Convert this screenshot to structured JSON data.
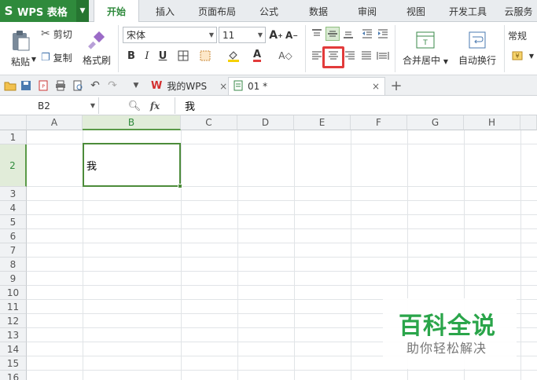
{
  "app": {
    "title": "WPS 表格",
    "logo": "S"
  },
  "menu_tabs": [
    {
      "label": "开始",
      "active": true
    },
    {
      "label": "插入"
    },
    {
      "label": "页面布局"
    },
    {
      "label": "公式"
    },
    {
      "label": "数据"
    },
    {
      "label": "审阅"
    },
    {
      "label": "视图"
    },
    {
      "label": "开发工具"
    },
    {
      "label": "云服务"
    }
  ],
  "ribbon": {
    "paste_label": "粘贴",
    "cut_label": "剪切",
    "copy_label": "复制",
    "format_painter_label": "格式刷",
    "font_name": "宋体",
    "font_size": "11",
    "bold": "B",
    "italic": "I",
    "underline": "U",
    "merge_center_label": "合并居中",
    "wrap_text_label": "自动换行",
    "number_format": "常规",
    "font_color": "#e23b3b",
    "fill_color": "#f5d000",
    "accent": "#2f8a3c"
  },
  "doc_tabs": [
    {
      "label": "我的WPS",
      "icon": "wps-logo-icon"
    },
    {
      "label": "01 *",
      "icon": "spreadsheet-file-icon",
      "active": true
    }
  ],
  "formula_bar": {
    "cell_ref": "B2",
    "fx": "fx",
    "content": "我"
  },
  "grid": {
    "columns": [
      "A",
      "B",
      "C",
      "D",
      "E",
      "F",
      "G",
      "H"
    ],
    "rows": [
      "1",
      "2",
      "3",
      "4",
      "5",
      "6",
      "7",
      "8",
      "9",
      "10",
      "11",
      "12",
      "13",
      "14",
      "15",
      "16"
    ],
    "selected_column": "B",
    "selected_row": "2",
    "active_cell_value": "我"
  },
  "watermark": {
    "line1": "百科全说",
    "line2": "助你轻松解决"
  }
}
